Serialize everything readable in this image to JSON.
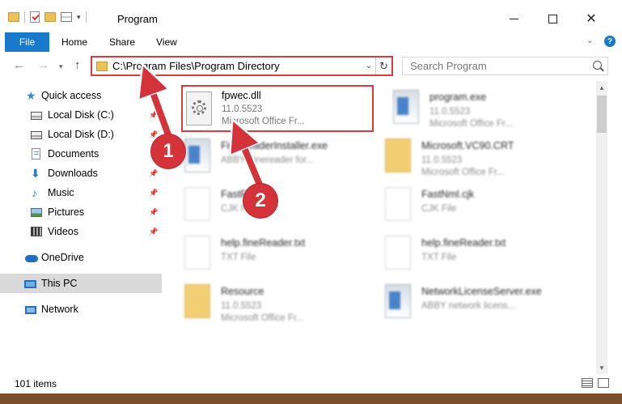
{
  "window": {
    "title": "Program",
    "minimize_icon": "minimize-icon",
    "maximize_icon": "maximize-icon",
    "close_icon": "close-icon",
    "close_glyph": "✕"
  },
  "ribbon": {
    "tabs": [
      "File",
      "Home",
      "Share",
      "View"
    ],
    "help_glyph": "?",
    "expand_glyph": "⌄"
  },
  "nav": {
    "back_glyph": "←",
    "forward_glyph": "→",
    "recent_glyph": "▾",
    "up_glyph": "↑"
  },
  "address": {
    "path": "C:\\Program Files\\Program Directory",
    "dropdown_glyph": "⌄",
    "refresh_glyph": "↻"
  },
  "search": {
    "placeholder": "Search Program"
  },
  "sidebar": {
    "items": [
      {
        "label": "Quick access",
        "icon": "star-icon",
        "glyph": "★"
      },
      {
        "label": "Local Disk (C:)",
        "icon": "disk-icon",
        "pinned": true
      },
      {
        "label": "Local Disk (D:)",
        "icon": "disk-icon",
        "pinned": true
      },
      {
        "label": "Documents",
        "icon": "documents-icon",
        "pinned": true
      },
      {
        "label": "Downloads",
        "icon": "download-icon",
        "glyph": "⬇",
        "pinned": true
      },
      {
        "label": "Music",
        "icon": "music-icon",
        "glyph": "♪",
        "pinned": true
      },
      {
        "label": "Pictures",
        "icon": "pictures-icon",
        "pinned": true
      },
      {
        "label": "Videos",
        "icon": "videos-icon",
        "pinned": true
      },
      {
        "label": "OneDrive",
        "icon": "cloud-icon"
      },
      {
        "label": "This PC",
        "icon": "computer-icon",
        "selected": true
      },
      {
        "label": "Network",
        "icon": "network-icon"
      }
    ],
    "pin_glyph": "📌"
  },
  "files": [
    {
      "name": "fpwec.dll",
      "line1": "11.0.5523",
      "line2": "Microsoft Office Fr...",
      "icon": "dll-gear-icon",
      "highlighted": true
    },
    {
      "name": "program.exe",
      "line1": "11.0.5523",
      "line2": "Microsoft Office Fr...",
      "icon": "exe-icon"
    },
    {
      "name": "FineReaderInstaller.exe",
      "line1": "ABBY Finereader for...",
      "line2": "",
      "icon": "exe-icon"
    },
    {
      "name": "Microsoft.VC90.CRT",
      "line1": "11.0.5523",
      "line2": "Microsoft Office Fr...",
      "icon": "folder-icon"
    },
    {
      "name": "FastFile.cjk",
      "line1": "CJK File",
      "line2": "",
      "icon": "file-icon"
    },
    {
      "name": "FastNml.cjk",
      "line1": "CJK File",
      "line2": "",
      "icon": "file-icon"
    },
    {
      "name": "help.fineReader.txt",
      "line1": "TXT File",
      "line2": "",
      "icon": "file-icon"
    },
    {
      "name": "help.fineReader.txt",
      "line1": "TXT File",
      "line2": "",
      "icon": "file-icon"
    },
    {
      "name": "Resource",
      "line1": "11.0.5523",
      "line2": "Microsoft Office Fr...",
      "icon": "folder-icon"
    },
    {
      "name": "NetworkLicenseServer.exe",
      "line1": "ABBY network licens...",
      "line2": "",
      "icon": "exe-icon"
    }
  ],
  "status": {
    "item_count": "101 items"
  },
  "annotations": [
    {
      "number": "1",
      "color": "#d5333a"
    },
    {
      "number": "2",
      "color": "#d5333a"
    }
  ],
  "colors": {
    "accent": "#1979ca",
    "highlight": "#e03a3e"
  }
}
